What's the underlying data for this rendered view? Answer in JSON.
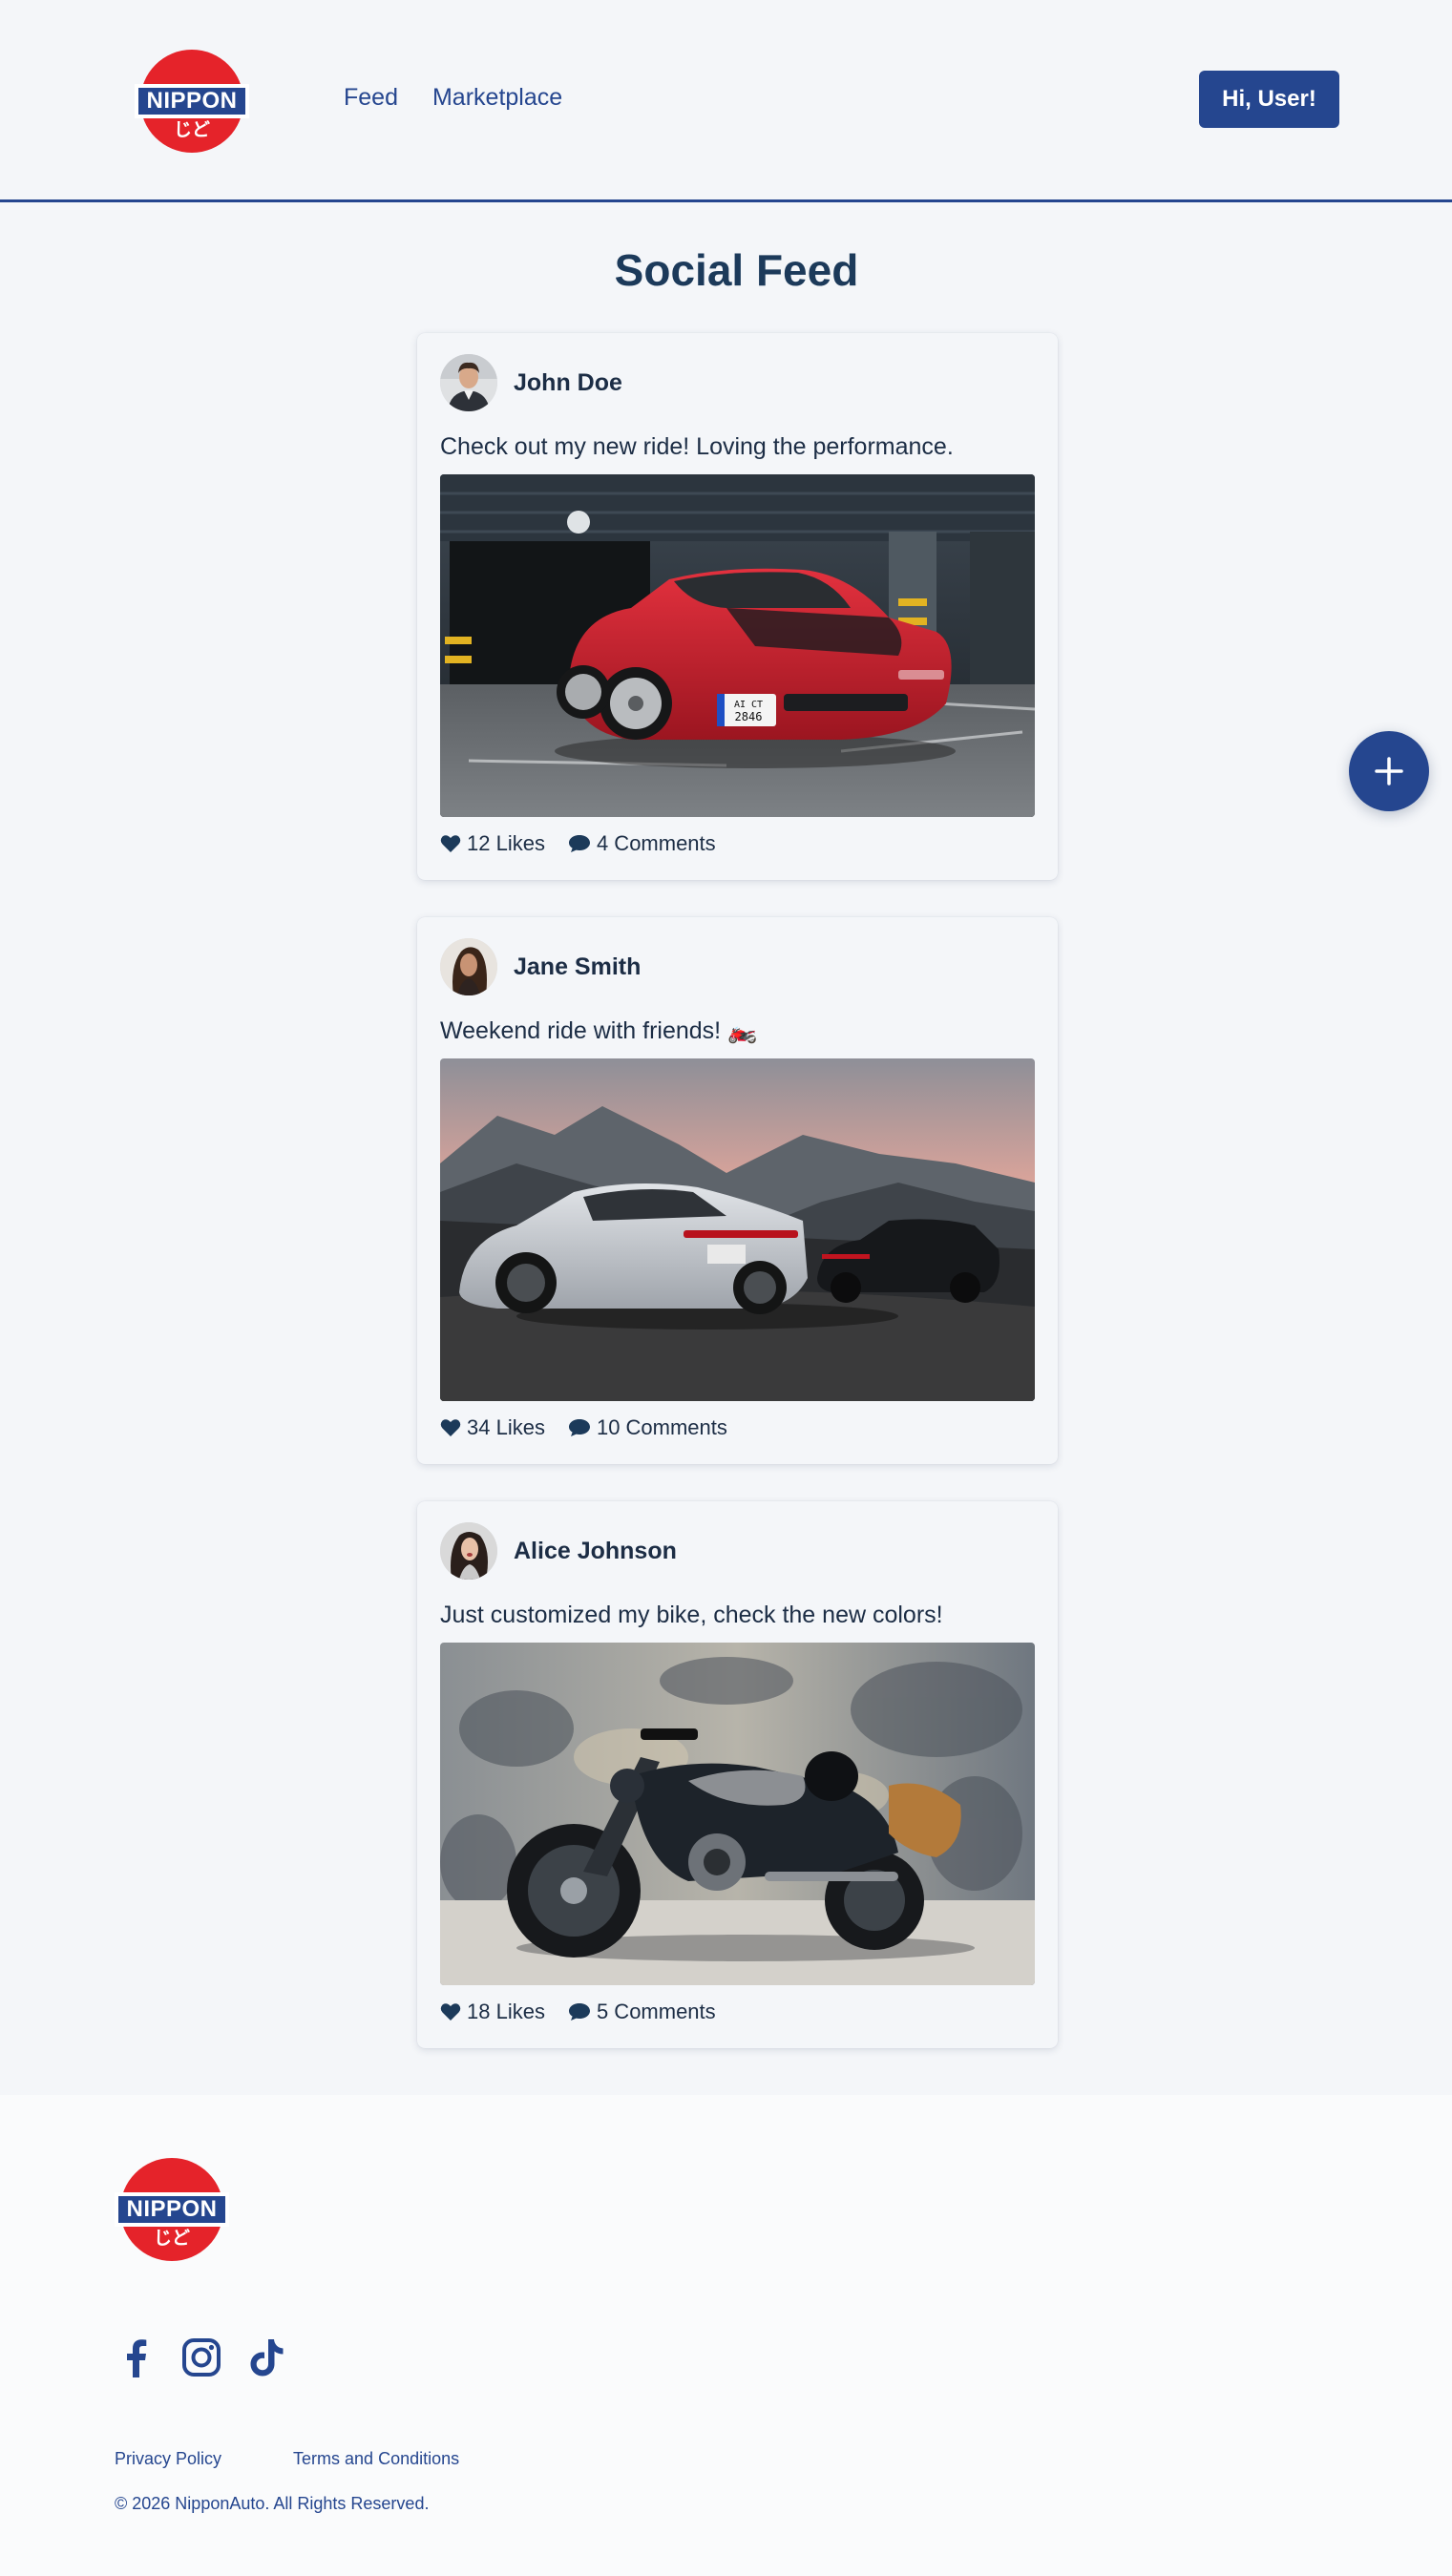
{
  "brand": {
    "name": "NIPPON",
    "kana": "じど",
    "colors": {
      "primary": "#25468f",
      "red": "#e5232a",
      "background": "#f4f6f9",
      "text": "#1c2d45"
    }
  },
  "nav": {
    "items": [
      {
        "label": "Feed"
      },
      {
        "label": "Marketplace"
      }
    ]
  },
  "header": {
    "user_button": "Hi, User!"
  },
  "page": {
    "title": "Social Feed"
  },
  "posts": [
    {
      "author": "John Doe",
      "caption": "Check out my new ride! Loving the performance.",
      "likes": "12 Likes",
      "comments": "4 Comments",
      "plate": "AI CT\n2846"
    },
    {
      "author": "Jane Smith",
      "caption": "Weekend ride with friends! 🏍️",
      "likes": "34 Likes",
      "comments": "10 Comments"
    },
    {
      "author": "Alice Johnson",
      "caption": "Just customized my bike, check the new colors!",
      "likes": "18 Likes",
      "comments": "5 Comments"
    }
  ],
  "fab": {
    "icon": "plus-icon"
  },
  "footer": {
    "socials": [
      "facebook-icon",
      "instagram-icon",
      "tiktok-icon"
    ],
    "links": [
      {
        "label": "Privacy Policy"
      },
      {
        "label": "Terms and Conditions"
      }
    ],
    "copyright": "© 2026 NipponAuto. All Rights Reserved."
  }
}
